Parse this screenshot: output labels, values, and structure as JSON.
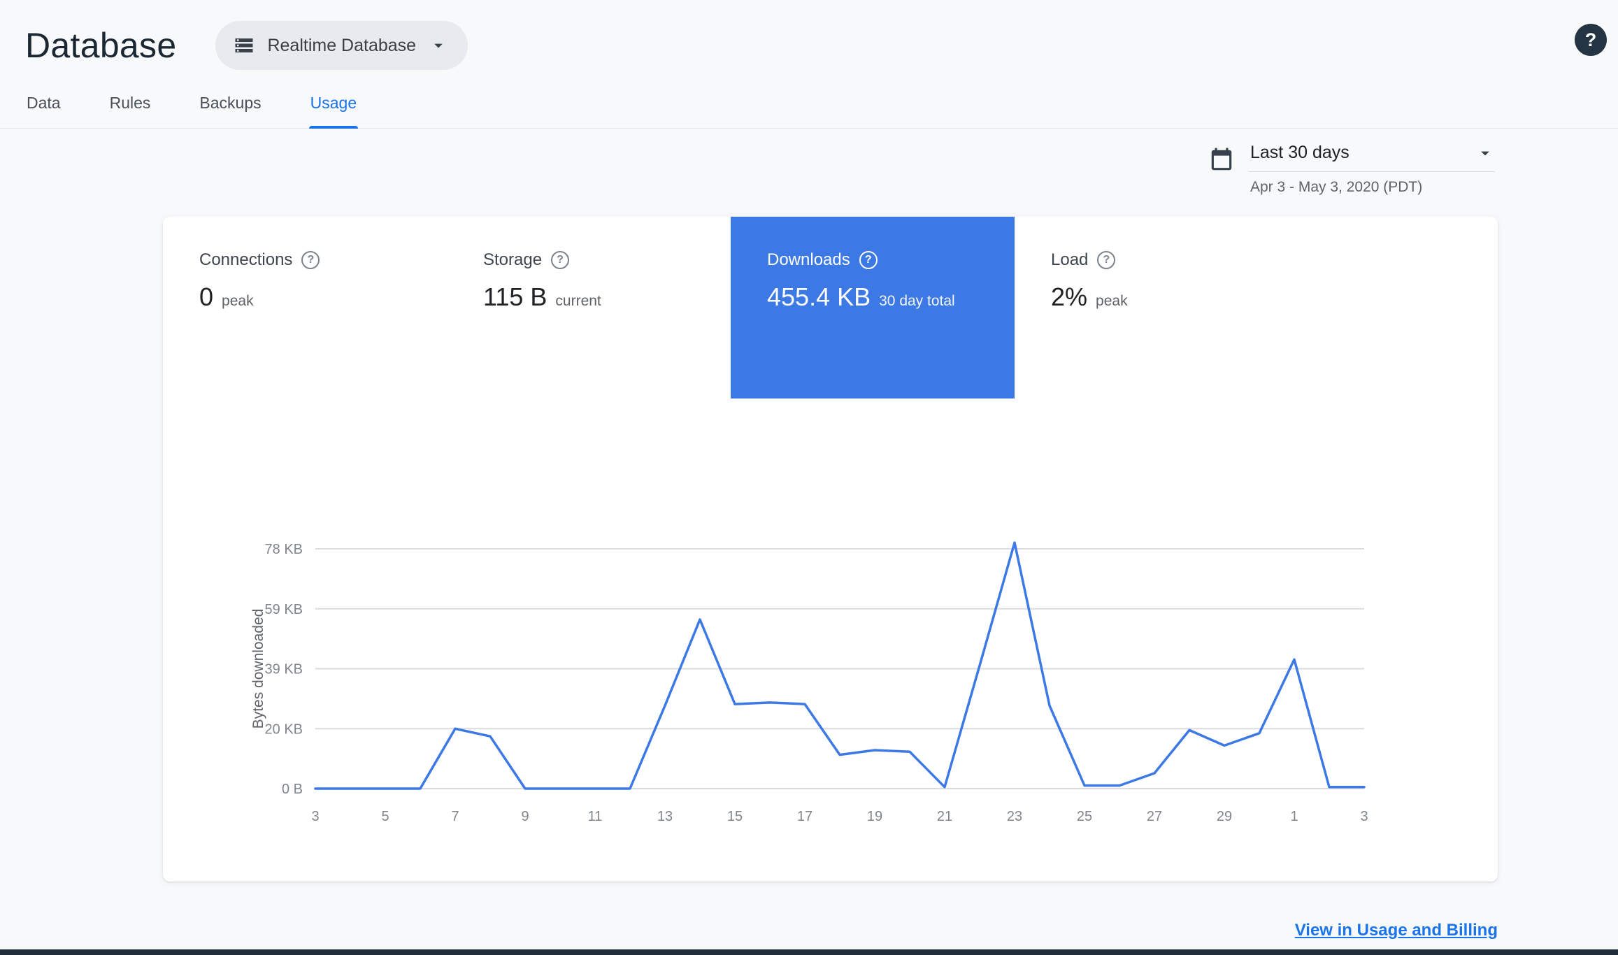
{
  "header": {
    "title": "Database",
    "selector_label": "Realtime Database"
  },
  "help_glyph": "?",
  "tabs": [
    {
      "label": "Data",
      "active": false
    },
    {
      "label": "Rules",
      "active": false
    },
    {
      "label": "Backups",
      "active": false
    },
    {
      "label": "Usage",
      "active": true
    }
  ],
  "date_range": {
    "preset": "Last 30 days",
    "detail": "Apr 3 - May 3, 2020 (PDT)"
  },
  "metrics": [
    {
      "label": "Connections",
      "value": "0",
      "unit": "peak",
      "selected": false
    },
    {
      "label": "Storage",
      "value": "115 B",
      "unit": "current",
      "selected": false
    },
    {
      "label": "Downloads",
      "value": "455.4 KB",
      "unit": "30 day total",
      "selected": true
    },
    {
      "label": "Load",
      "value": "2%",
      "unit": "peak",
      "selected": false
    }
  ],
  "footer_link": "View in Usage and Billing",
  "icons": {
    "database": "storage-stack",
    "pill_caret": "chevron-down",
    "help": "question-mark-circle",
    "calendar": "calendar",
    "date_caret": "chevron-down",
    "metric_help": "question-mark-circle"
  },
  "colors": {
    "accent_blue": "#3C79E5",
    "link_blue": "#1A73E8",
    "navy_dark": "#243442",
    "page_bg": "#F8F9FA",
    "grid_gray": "#DADCE0"
  },
  "chart_data": {
    "type": "line",
    "title": "Downloads, bytes per day, Apr 3 - May 3 2020",
    "xlabel": "",
    "ylabel": "Bytes downloaded",
    "x_tick_labels": [
      "3",
      "5",
      "7",
      "9",
      "11",
      "13",
      "15",
      "17",
      "19",
      "21",
      "23",
      "25",
      "27",
      "29",
      "1",
      "3"
    ],
    "y_ticks": [
      {
        "value": 0,
        "label": "0 B"
      },
      {
        "value": 19.5,
        "label": "20 KB"
      },
      {
        "value": 39,
        "label": "39 KB"
      },
      {
        "value": 58.5,
        "label": "59 KB"
      },
      {
        "value": 78,
        "label": "78 KB"
      }
    ],
    "values_kb": [
      0,
      0,
      0,
      0,
      19.5,
      17,
      0,
      0,
      0,
      0,
      27,
      55,
      27.5,
      28,
      27.5,
      11,
      12.5,
      12,
      0.5,
      40,
      80,
      27,
      1,
      1,
      5,
      19,
      14,
      18,
      42,
      0.5,
      0.5
    ],
    "ylim": [
      0,
      82
    ],
    "grid": true,
    "legend": false,
    "line_color": "#3C79E5",
    "grid_color": "#dadce0",
    "tick_color": "#80868b",
    "ylabel_color": "#5f6368"
  }
}
